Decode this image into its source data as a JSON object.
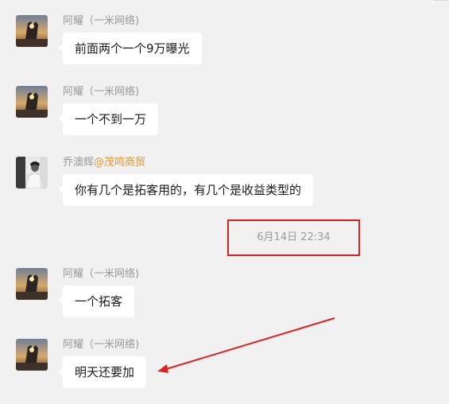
{
  "messages": [
    {
      "sender": "阿耀（一米网络)",
      "text": "前面两个一个9万曝光",
      "avatar": "sunset-heart-hands-avatar"
    },
    {
      "sender": "阿耀（一米网络)",
      "text": "一个不到一万",
      "avatar": "sunset-heart-hands-avatar"
    },
    {
      "sender": "乔澳辉",
      "sender_org": "@茂鸣商贸",
      "text": "你有几个是拓客用的，有几个是收益类型的",
      "avatar": "person-bw-avatar"
    },
    {
      "sender": "阿耀（一米网络)",
      "text": "一个拓客",
      "avatar": "sunset-heart-hands-avatar"
    },
    {
      "sender": "阿耀（一米网络)",
      "text": "明天还要加",
      "avatar": "sunset-heart-hands-avatar"
    }
  ],
  "timestamp": "6月14日 22:34",
  "colors": {
    "background": "#f1f1f1",
    "bubble": "#ffffff",
    "sender": "#999999",
    "org": "#e8912c",
    "annotation": "#e02020"
  }
}
